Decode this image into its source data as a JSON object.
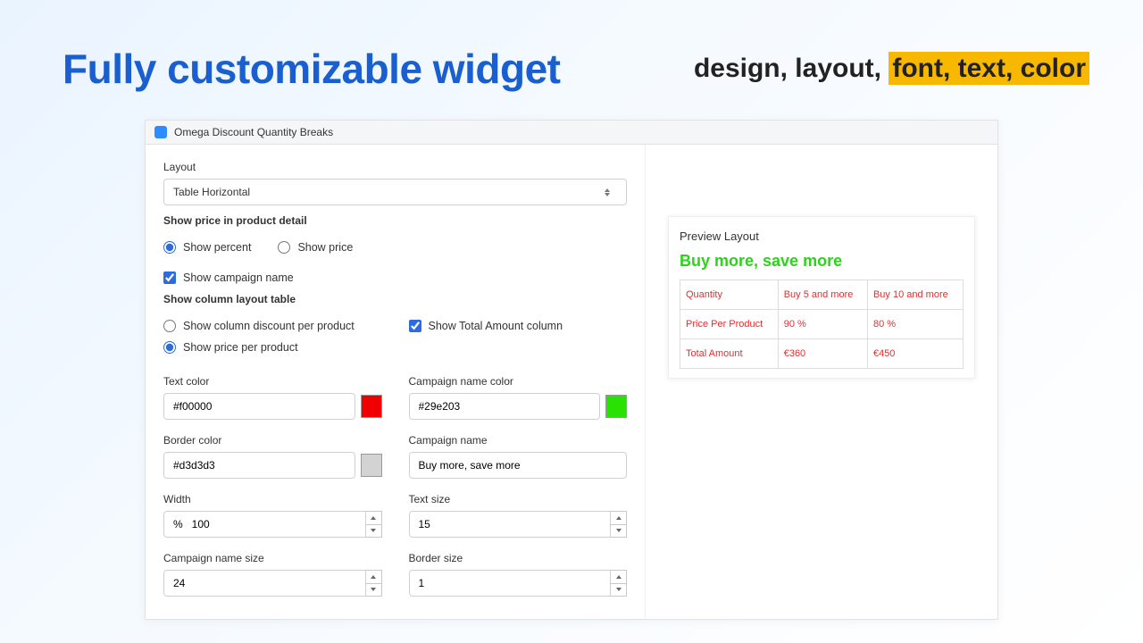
{
  "header": {
    "title_main": "Fully customizable widget",
    "title_sub_plain": "design, layout, ",
    "title_sub_hl": "font, text, color"
  },
  "app": {
    "name": "Omega Discount Quantity Breaks"
  },
  "settings": {
    "layout_label": "Layout",
    "layout_value": "Table Horizontal",
    "show_price_detail_label": "Show price in product detail",
    "show_percent": "Show percent",
    "show_price": "Show price",
    "show_campaign_name": "Show campaign name",
    "show_column_layout_label": "Show column layout table",
    "show_col_discount": "Show column discount per product",
    "show_total_amount": "Show Total Amount column",
    "show_price_per_product": "Show price per product",
    "text_color_label": "Text color",
    "text_color_value": "#f00000",
    "campaign_color_label": "Campaign name color",
    "campaign_color_value": "#29e203",
    "border_color_label": "Border color",
    "border_color_value": "#d3d3d3",
    "campaign_name_label": "Campaign name",
    "campaign_name_value": "Buy more, save more",
    "width_label": "Width",
    "width_value": "%   100",
    "text_size_label": "Text size",
    "text_size_value": "15",
    "campaign_size_label": "Campaign name size",
    "campaign_size_value": "24",
    "border_size_label": "Border size",
    "border_size_value": "1"
  },
  "preview": {
    "title": "Preview Layout",
    "campaign": "Buy more, save more",
    "headers": [
      "Quantity",
      "Buy 5 and more",
      "Buy 10 and more"
    ],
    "rows": [
      [
        "Price Per Product",
        "90 %",
        "80 %"
      ],
      [
        "Total Amount",
        "€360",
        "€450"
      ]
    ]
  }
}
